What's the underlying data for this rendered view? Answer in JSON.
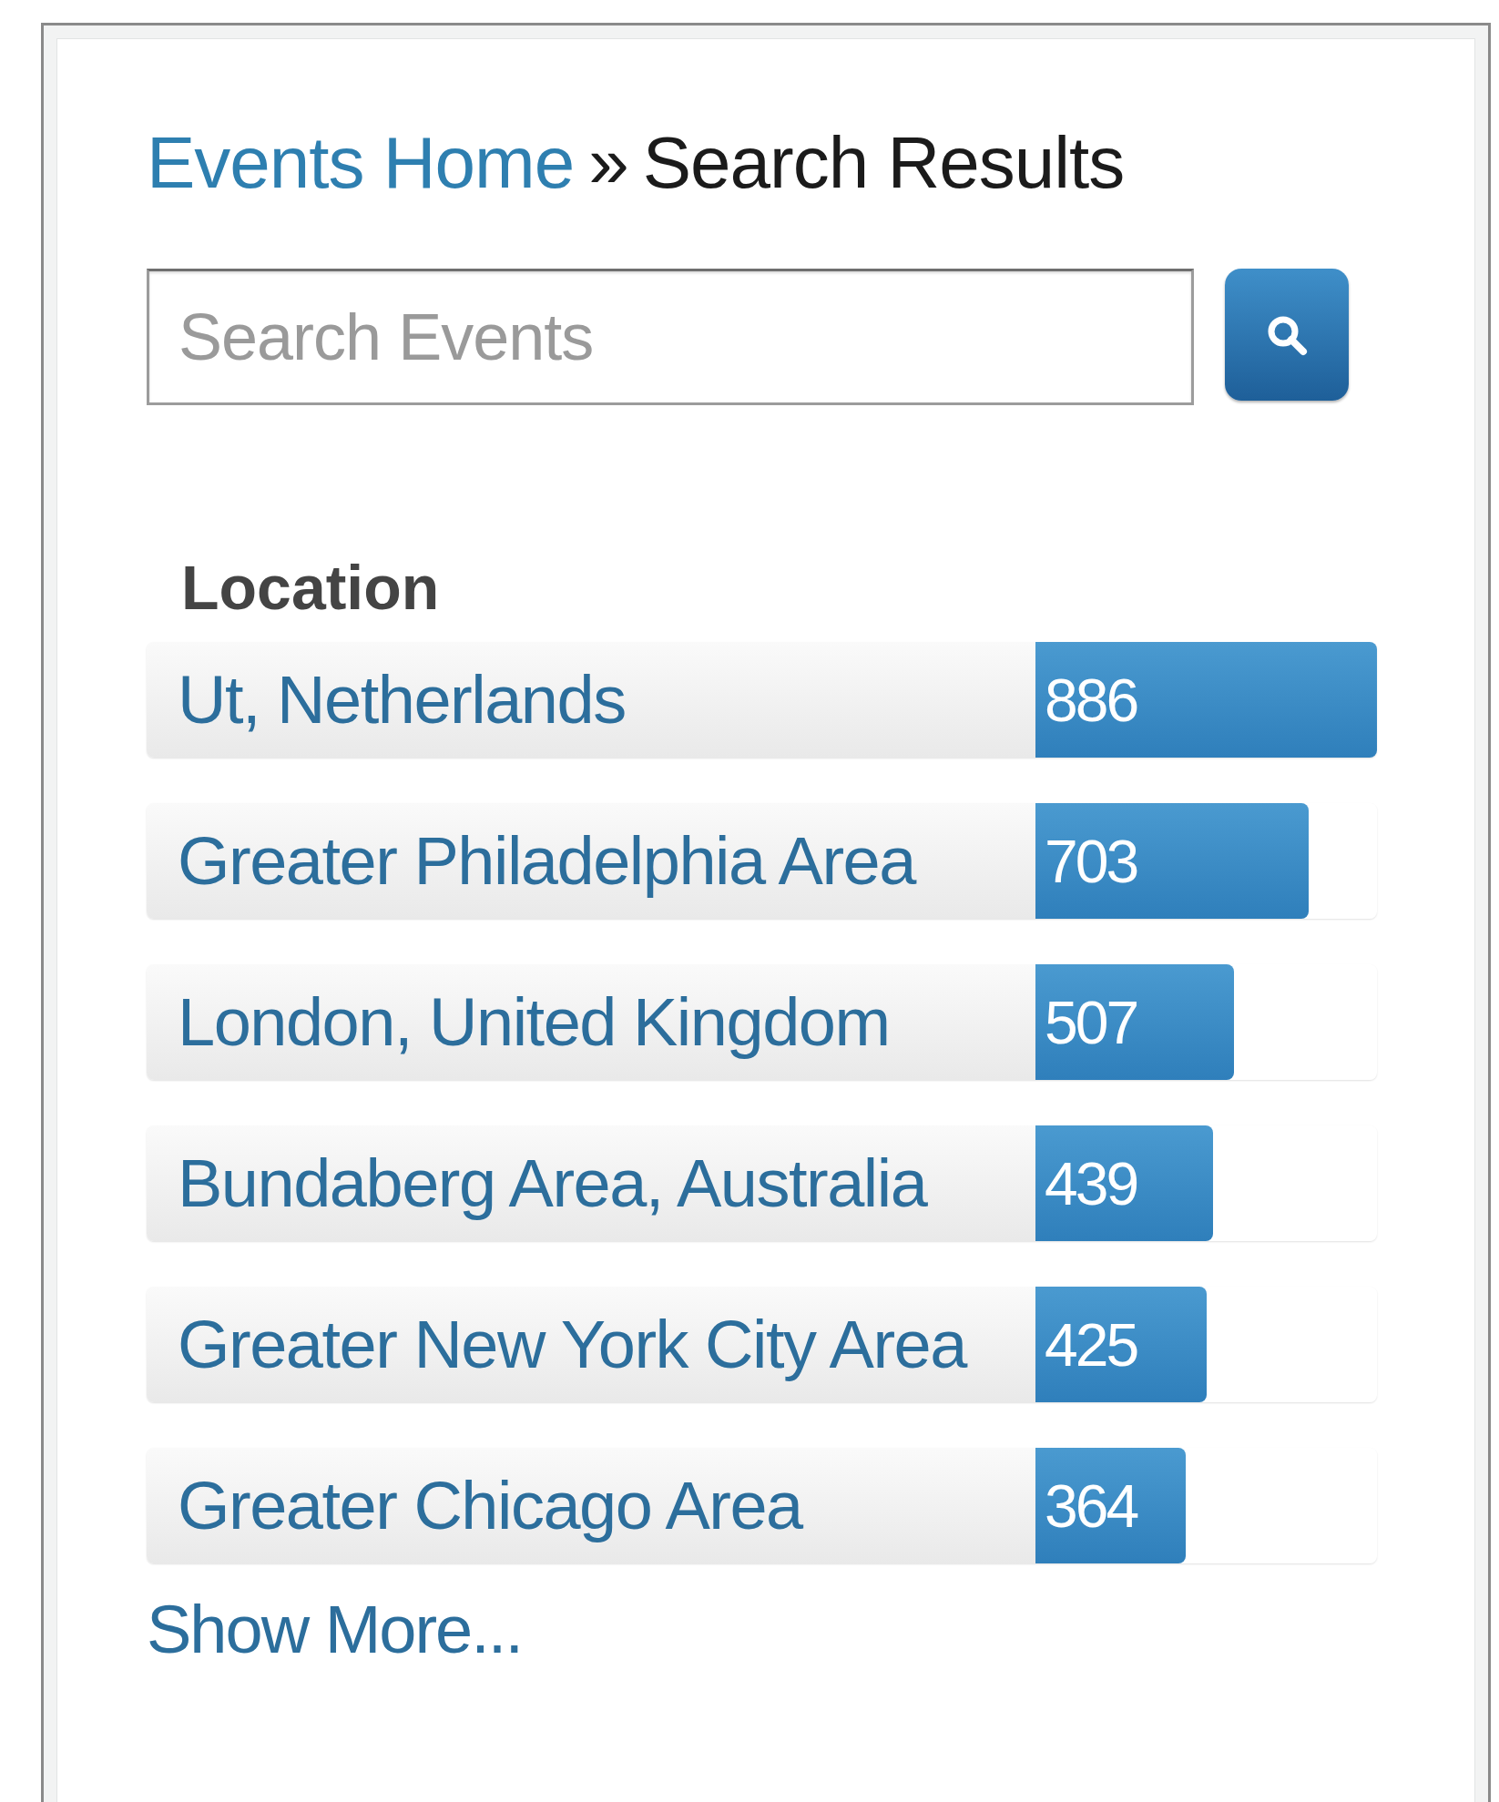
{
  "breadcrumb": {
    "link": "Events Home",
    "separator": "»",
    "current": "Search Results"
  },
  "search": {
    "placeholder": "Search Events"
  },
  "facet": {
    "title": "Location",
    "items": [
      {
        "label": "Ut, Netherlands",
        "count": "886",
        "level": 1
      },
      {
        "label": "Greater Philadelphia Area",
        "count": "703",
        "level": 0.8
      },
      {
        "label": "London, United Kingdom",
        "count": "507",
        "level": 0.58
      },
      {
        "label": "Bundaberg Area, Australia",
        "count": "439",
        "level": 0.52
      },
      {
        "label": "Greater New York City Area",
        "count": "425",
        "level": 0.5
      },
      {
        "label": "Greater Chicago Area",
        "count": "364",
        "level": 0.44
      }
    ],
    "more": "Show More..."
  }
}
